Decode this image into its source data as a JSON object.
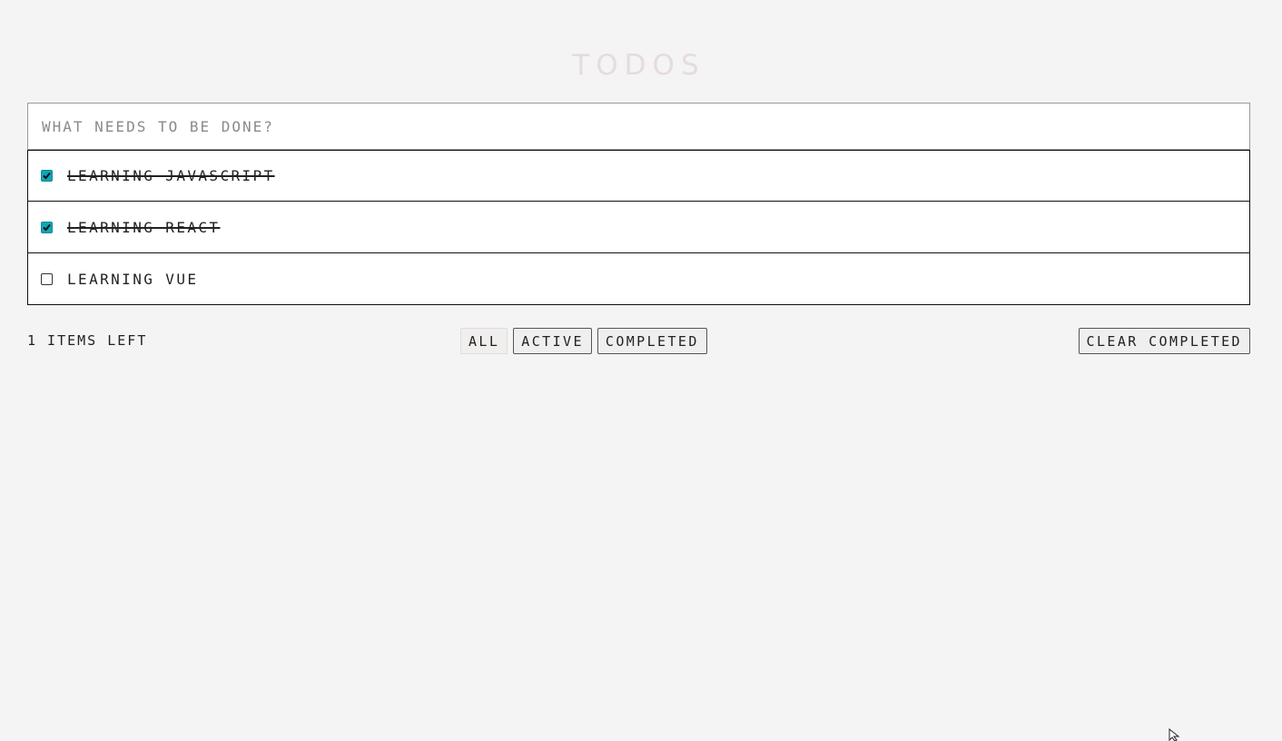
{
  "header": {
    "title": "TODOS"
  },
  "new_todo": {
    "placeholder": "WHAT NEEDS TO BE DONE?",
    "value": ""
  },
  "todos": [
    {
      "text": "LEARNING JAVASCRIPT",
      "completed": true
    },
    {
      "text": "LEARNING REACT",
      "completed": true
    },
    {
      "text": "LEARNING VUE",
      "completed": false
    }
  ],
  "footer": {
    "items_left": "1 ITEMS LEFT",
    "filters": [
      {
        "label": "ALL",
        "selected": true
      },
      {
        "label": "ACTIVE",
        "selected": false
      },
      {
        "label": "COMPLETED",
        "selected": false
      }
    ],
    "clear_label": "CLEAR COMPLETED"
  },
  "colors": {
    "checkbox_checked": "#0fa6b6",
    "title": "#e6dcdc",
    "background": "#f4f4f4"
  },
  "icons": {
    "checkbox": "check-icon",
    "cursor": "mouse-pointer-icon"
  }
}
